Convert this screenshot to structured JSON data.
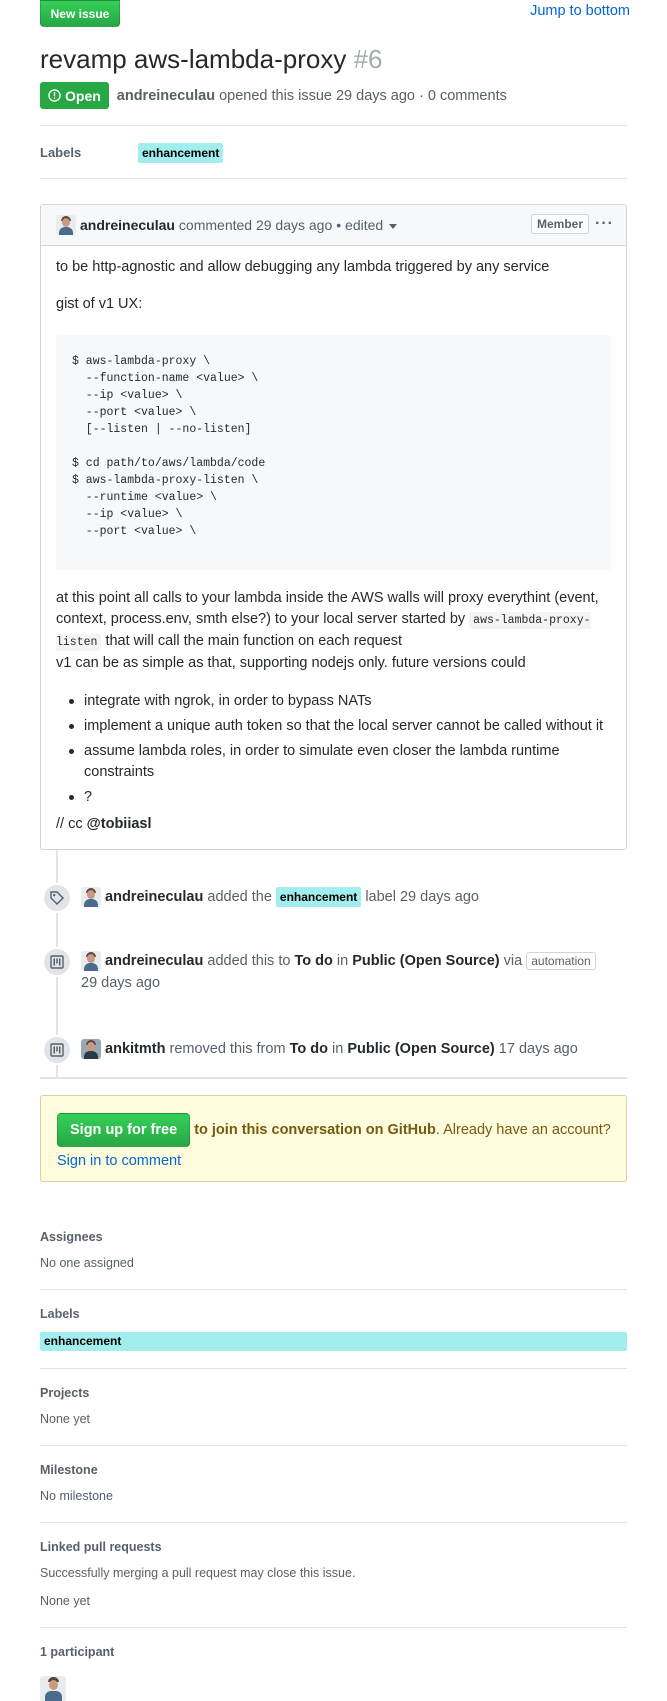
{
  "header": {
    "new_issue_label": "New issue",
    "jump_label": "Jump to bottom",
    "title": "revamp aws-lambda-proxy",
    "number": "#6",
    "state_label": "Open",
    "author": "andreineculau",
    "meta": "opened this issue 29 days ago · 0 comments"
  },
  "labels_row": {
    "heading": "Labels",
    "label": "enhancement",
    "label_color": "#a2eeef"
  },
  "comment": {
    "author": "andreineculau",
    "meta": "commented 29 days ago",
    "edited": "• edited",
    "badge": "Member",
    "menu": "···",
    "p1": "to be http-agnostic and allow debugging any lambda triggered by any service",
    "p2": "gist of v1 UX:",
    "code": "$ aws-lambda-proxy \\\n  --function-name <value> \\\n  --ip <value> \\\n  --port <value> \\\n  [--listen | --no-listen]\n\n$ cd path/to/aws/lambda/code\n$ aws-lambda-proxy-listen \\\n  --runtime <value> \\\n  --ip <value> \\\n  --port <value> \\",
    "p3_before": "at this point all calls to your lambda inside the AWS walls will proxy everythint (event, context, process.env, smth else?) to your local server started by",
    "p3_code": "aws-lambda-proxy-listen",
    "p3_after": "that will call the main function on each request",
    "p4": "v1 can be as simple as that, supporting nodejs only. future versions could",
    "bullets": [
      "integrate with ngrok, in order to bypass NATs",
      "implement a unique auth token so that the local server cannot be called without it",
      "assume lambda roles, in order to simulate even closer the lambda runtime constraints",
      "?"
    ],
    "cc_prefix": "// cc",
    "cc_user": "@tobiiasl"
  },
  "timeline": {
    "e1": {
      "user": "andreineculau",
      "pre": "added the",
      "label": "enhancement",
      "post": "label 29 days ago"
    },
    "e2": {
      "user": "andreineculau",
      "pre": "added this to",
      "column": "To do",
      "in": "in",
      "project": "Public (Open Source)",
      "via": "via",
      "badge": "automation",
      "time": "29 days ago"
    },
    "e3": {
      "user": "ankitmth",
      "pre": "removed this from",
      "column": "To do",
      "in": "in",
      "project": "Public (Open Source)",
      "time": "17 days ago"
    }
  },
  "signup": {
    "button": "Sign up for free",
    "text_bold": "to join this conversation on GitHub",
    "text": ". Already have an account?",
    "link": "Sign in to comment"
  },
  "sidebar": {
    "assignees_heading": "Assignees",
    "assignees_value": "No one assigned",
    "labels_heading": "Labels",
    "labels_value": "enhancement",
    "projects_heading": "Projects",
    "projects_value": "None yet",
    "milestone_heading": "Milestone",
    "milestone_value": "No milestone",
    "linked_heading": "Linked pull requests",
    "linked_desc": "Successfully merging a pull request may close this issue.",
    "linked_value": "None yet",
    "participants_heading": "1 participant"
  }
}
